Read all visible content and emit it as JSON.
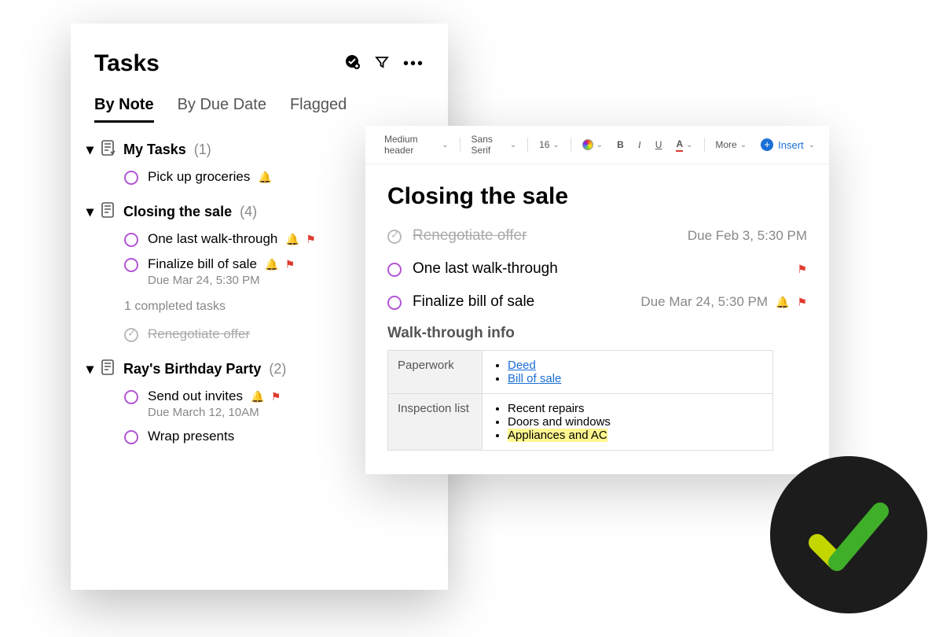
{
  "tasks_panel": {
    "title": "Tasks",
    "tabs": [
      "By Note",
      "By Due Date",
      "Flagged"
    ],
    "active_tab": 0,
    "sections": [
      {
        "name": "My Tasks",
        "count_label": "(1)",
        "items": [
          {
            "text": "Pick up groceries",
            "reminder": true
          }
        ]
      },
      {
        "name": "Closing the sale",
        "count_label": "(4)",
        "items": [
          {
            "text": "One last walk-through",
            "reminder": true,
            "flag": true
          },
          {
            "text": "Finalize bill of sale",
            "sub": "Due Mar 24, 5:30 PM",
            "reminder": true,
            "flag": true
          }
        ],
        "completed_line": "1 completed tasks",
        "completed": [
          {
            "text": "Renegotiate offer"
          }
        ]
      },
      {
        "name": "Ray's Birthday Party",
        "count_label": "(2)",
        "items": [
          {
            "text": "Send out invites",
            "sub": "Due March 12, 10AM",
            "reminder": true,
            "flag": true
          },
          {
            "text": "Wrap presents"
          }
        ]
      }
    ]
  },
  "editor": {
    "toolbar": {
      "style_label": "Medium header",
      "font_label": "Sans Serif",
      "size_label": "16",
      "more_label": "More",
      "insert_label": "Insert"
    },
    "title": "Closing the sale",
    "rows": [
      {
        "done": true,
        "text": "Renegotiate offer",
        "due": "Due Feb 3, 5:30 PM"
      },
      {
        "done": false,
        "text": "One last walk-through",
        "flag": true
      },
      {
        "done": false,
        "text": "Finalize bill of sale",
        "due": "Due Mar 24, 5:30 PM",
        "reminder": true,
        "flag": true
      }
    ],
    "subheading": "Walk-through info",
    "table": {
      "paperwork_label": "Paperwork",
      "paperwork_links": [
        "Deed",
        "Bill of sale"
      ],
      "inspection_label": "Inspection list",
      "inspection_items": [
        "Recent repairs",
        "Doors and windows",
        "Appliances and AC"
      ],
      "highlighted_index": 2
    }
  }
}
